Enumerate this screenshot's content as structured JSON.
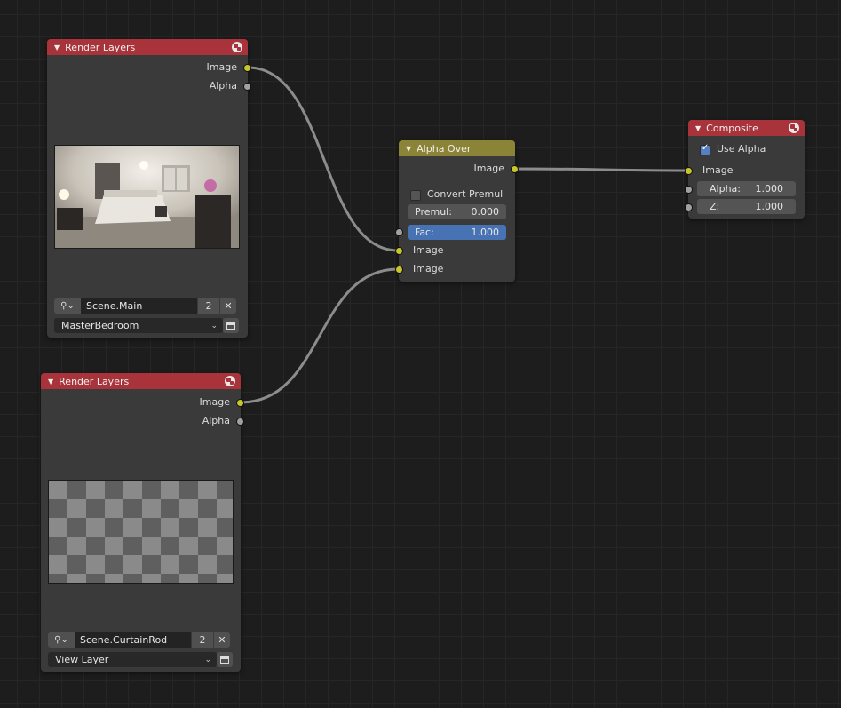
{
  "colors": {
    "render_layers_header": "#a8333b",
    "composite_header": "#a8333b",
    "alpha_over_header": "#8b8335",
    "socket_image": "#c7c729",
    "socket_value": "#a1a1a1",
    "fac_field": "#4772b3",
    "link": "#8c8c8c"
  },
  "render_layers_1": {
    "title": "Render Layers",
    "outputs": [
      "Image",
      "Alpha"
    ],
    "scene_name": "Scene.Main",
    "scene_users": "2",
    "view_layer": "MasterBedroom",
    "preview": "bedroom-render-preview"
  },
  "render_layers_2": {
    "title": "Render Layers",
    "outputs": [
      "Image",
      "Alpha"
    ],
    "scene_name": "Scene.CurtainRod",
    "scene_users": "2",
    "view_layer": "View Layer",
    "preview": "transparent-checker-preview"
  },
  "alpha_over": {
    "title": "Alpha Over",
    "output": "Image",
    "convert_premul_label": "Convert Premul",
    "convert_premul_checked": false,
    "premul_label": "Premul:",
    "premul_value": "0.000",
    "fac_label": "Fac:",
    "fac_value": "1.000",
    "inputs": [
      "Image",
      "Image"
    ]
  },
  "composite": {
    "title": "Composite",
    "use_alpha_label": "Use Alpha",
    "use_alpha_checked": true,
    "image_label": "Image",
    "alpha_label": "Alpha:",
    "alpha_value": "1.000",
    "z_label": "Z:",
    "z_value": "1.000"
  }
}
